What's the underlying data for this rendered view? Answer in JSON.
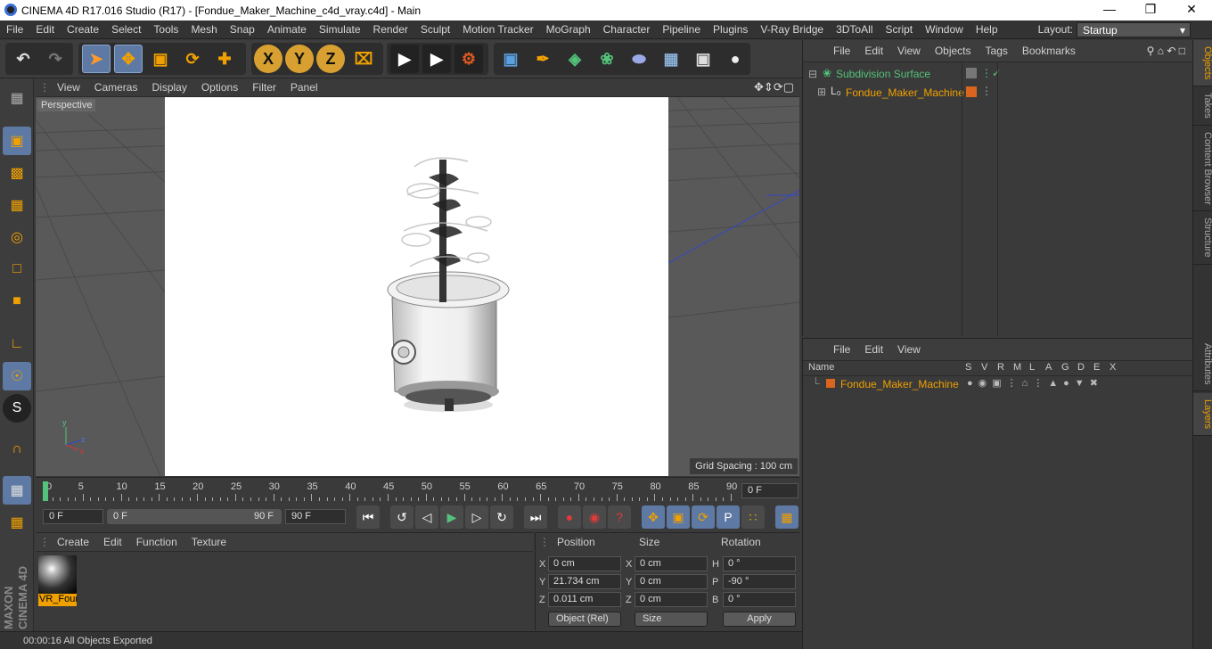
{
  "window": {
    "title": "CINEMA 4D R17.016 Studio (R17) - [Fondue_Maker_Machine_c4d_vray.c4d] - Main"
  },
  "menu": [
    "File",
    "Edit",
    "Create",
    "Select",
    "Tools",
    "Mesh",
    "Snap",
    "Animate",
    "Simulate",
    "Render",
    "Sculpt",
    "Motion Tracker",
    "MoGraph",
    "Character",
    "Pipeline",
    "Plugins",
    "V-Ray Bridge",
    "3DToAll",
    "Script",
    "Window",
    "Help"
  ],
  "layout": {
    "label": "Layout:",
    "value": "Startup"
  },
  "viewport": {
    "menu": [
      "View",
      "Cameras",
      "Display",
      "Options",
      "Filter",
      "Panel"
    ],
    "camera_label": "Perspective",
    "grid_spacing": "Grid Spacing : 100 cm"
  },
  "timeline": {
    "ticks": [
      "0",
      "5",
      "10",
      "15",
      "20",
      "25",
      "30",
      "35",
      "40",
      "45",
      "50",
      "55",
      "60",
      "65",
      "70",
      "75",
      "80",
      "85",
      "90"
    ],
    "current_frame": "0 F",
    "start_field": "0 F",
    "range_start": "0 F",
    "range_end": "90 F",
    "end_field": "90 F"
  },
  "material_panel": {
    "menu": [
      "Create",
      "Edit",
      "Function",
      "Texture"
    ],
    "material_name": "VR_Fount"
  },
  "coordinates": {
    "headers": {
      "position": "Position",
      "size": "Size",
      "rotation": "Rotation"
    },
    "rows": [
      {
        "pl": "X",
        "pv": "0 cm",
        "sl": "X",
        "sv": "0 cm",
        "rl": "H",
        "rv": "0 °"
      },
      {
        "pl": "Y",
        "pv": "21.734 cm",
        "sl": "Y",
        "sv": "0 cm",
        "rl": "P",
        "rv": "-90 °"
      },
      {
        "pl": "Z",
        "pv": "0.011 cm",
        "sl": "Z",
        "sv": "0 cm",
        "rl": "B",
        "rv": "0 °"
      }
    ],
    "mode": "Object (Rel)",
    "size_mode": "Size",
    "apply": "Apply"
  },
  "status": "00:00:16 All Objects Exported",
  "objects_panel": {
    "menu": [
      "File",
      "Edit",
      "View",
      "Objects",
      "Tags",
      "Bookmarks"
    ],
    "items": [
      "Subdivision Surface",
      "Fondue_Maker_Machine"
    ]
  },
  "layers_panel": {
    "menu": [
      "File",
      "Edit",
      "View"
    ],
    "columns": [
      "Name",
      "S",
      "V",
      "R",
      "M",
      "L",
      "A",
      "G",
      "D",
      "E",
      "X"
    ],
    "items": [
      "Fondue_Maker_Machine"
    ]
  },
  "right_tabs": [
    "Objects",
    "Takes",
    "Content Browser",
    "Structure",
    "Attributes",
    "Layers"
  ],
  "brand": {
    "line1": "MAXON",
    "line2": "CINEMA 4D"
  },
  "colors": {
    "accent": "#f0a000",
    "selected_tool": "#5e79a3",
    "object_green": "#54c27a",
    "layer_orange": "#d9651e"
  }
}
